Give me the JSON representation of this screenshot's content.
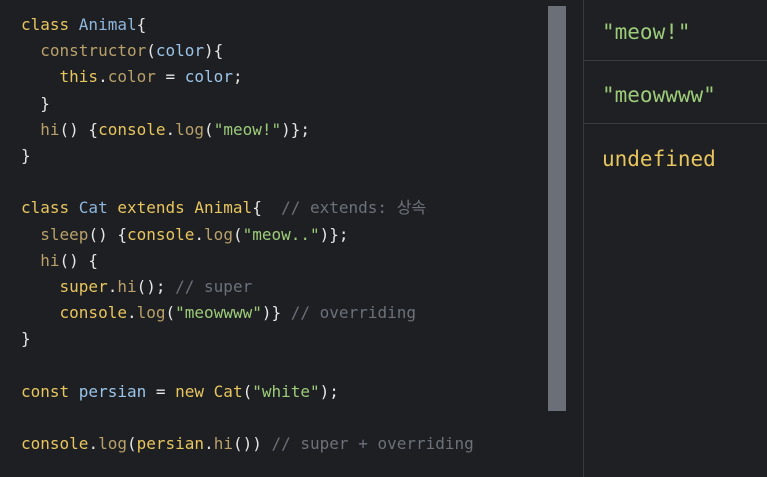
{
  "editor": {
    "lines": [
      [
        {
          "t": "class ",
          "c": "kw"
        },
        {
          "t": "Animal",
          "c": "cls"
        },
        {
          "t": "{",
          "c": "pun"
        }
      ],
      [
        {
          "t": "  ",
          "c": "pun"
        },
        {
          "t": "constructor",
          "c": "fn"
        },
        {
          "t": "(",
          "c": "pun"
        },
        {
          "t": "color",
          "c": "var"
        },
        {
          "t": "){",
          "c": "pun"
        }
      ],
      [
        {
          "t": "    ",
          "c": "pun"
        },
        {
          "t": "this",
          "c": "kw"
        },
        {
          "t": ".",
          "c": "pun"
        },
        {
          "t": "color",
          "c": "fn"
        },
        {
          "t": " = ",
          "c": "pun"
        },
        {
          "t": "color",
          "c": "var"
        },
        {
          "t": ";",
          "c": "pun"
        }
      ],
      [
        {
          "t": "  }",
          "c": "pun"
        }
      ],
      [
        {
          "t": "  ",
          "c": "pun"
        },
        {
          "t": "hi",
          "c": "fn"
        },
        {
          "t": "() {",
          "c": "pun"
        },
        {
          "t": "console",
          "c": "obj"
        },
        {
          "t": ".",
          "c": "pun"
        },
        {
          "t": "log",
          "c": "fn"
        },
        {
          "t": "(",
          "c": "pun"
        },
        {
          "t": "\"meow!\"",
          "c": "str"
        },
        {
          "t": ")};",
          "c": "pun"
        }
      ],
      [
        {
          "t": "}",
          "c": "pun"
        }
      ],
      [],
      [
        {
          "t": "class ",
          "c": "kw"
        },
        {
          "t": "Cat ",
          "c": "cls"
        },
        {
          "t": "extends ",
          "c": "kw"
        },
        {
          "t": "Animal",
          "c": "kw"
        },
        {
          "t": "{  ",
          "c": "pun"
        },
        {
          "t": "// extends: 상속",
          "c": "com"
        }
      ],
      [
        {
          "t": "  ",
          "c": "pun"
        },
        {
          "t": "sleep",
          "c": "fn"
        },
        {
          "t": "() {",
          "c": "pun"
        },
        {
          "t": "console",
          "c": "obj"
        },
        {
          "t": ".",
          "c": "pun"
        },
        {
          "t": "log",
          "c": "fn"
        },
        {
          "t": "(",
          "c": "pun"
        },
        {
          "t": "\"meow..\"",
          "c": "str"
        },
        {
          "t": ")};",
          "c": "pun"
        }
      ],
      [
        {
          "t": "  ",
          "c": "pun"
        },
        {
          "t": "hi",
          "c": "fn"
        },
        {
          "t": "() {",
          "c": "pun"
        }
      ],
      [
        {
          "t": "    ",
          "c": "pun"
        },
        {
          "t": "super",
          "c": "kw"
        },
        {
          "t": ".",
          "c": "pun"
        },
        {
          "t": "hi",
          "c": "fn"
        },
        {
          "t": "(); ",
          "c": "pun"
        },
        {
          "t": "// super",
          "c": "com"
        }
      ],
      [
        {
          "t": "    ",
          "c": "pun"
        },
        {
          "t": "console",
          "c": "obj"
        },
        {
          "t": ".",
          "c": "pun"
        },
        {
          "t": "log",
          "c": "fn"
        },
        {
          "t": "(",
          "c": "pun"
        },
        {
          "t": "\"meowwww\"",
          "c": "str"
        },
        {
          "t": ")} ",
          "c": "pun"
        },
        {
          "t": "// overriding",
          "c": "com"
        }
      ],
      [
        {
          "t": "}",
          "c": "pun"
        }
      ],
      [],
      [
        {
          "t": "const ",
          "c": "kw"
        },
        {
          "t": "persian",
          "c": "var"
        },
        {
          "t": " = ",
          "c": "pun"
        },
        {
          "t": "new ",
          "c": "kw"
        },
        {
          "t": "Cat",
          "c": "kw"
        },
        {
          "t": "(",
          "c": "pun"
        },
        {
          "t": "\"white\"",
          "c": "str"
        },
        {
          "t": ");",
          "c": "pun"
        }
      ],
      [],
      [
        {
          "t": "console",
          "c": "obj"
        },
        {
          "t": ".",
          "c": "pun"
        },
        {
          "t": "log",
          "c": "fn"
        },
        {
          "t": "(",
          "c": "pun"
        },
        {
          "t": "persian",
          "c": "obj"
        },
        {
          "t": ".",
          "c": "pun"
        },
        {
          "t": "hi",
          "c": "fn"
        },
        {
          "t": "()) ",
          "c": "pun"
        },
        {
          "t": "// super + overriding",
          "c": "com"
        }
      ]
    ]
  },
  "output": {
    "rows": [
      {
        "text": "\"meow!\"",
        "kind": "str"
      },
      {
        "text": "\"meowwww\"",
        "kind": "str"
      },
      {
        "text": "undefined",
        "kind": "undef"
      }
    ]
  },
  "colors": {
    "background": "#1e1f22",
    "keyword": "#e7c55f",
    "string": "#9ccc7a",
    "comment": "#6c717a",
    "identifier": "#8fb7dd",
    "scrollbar": "#6b6f78"
  }
}
